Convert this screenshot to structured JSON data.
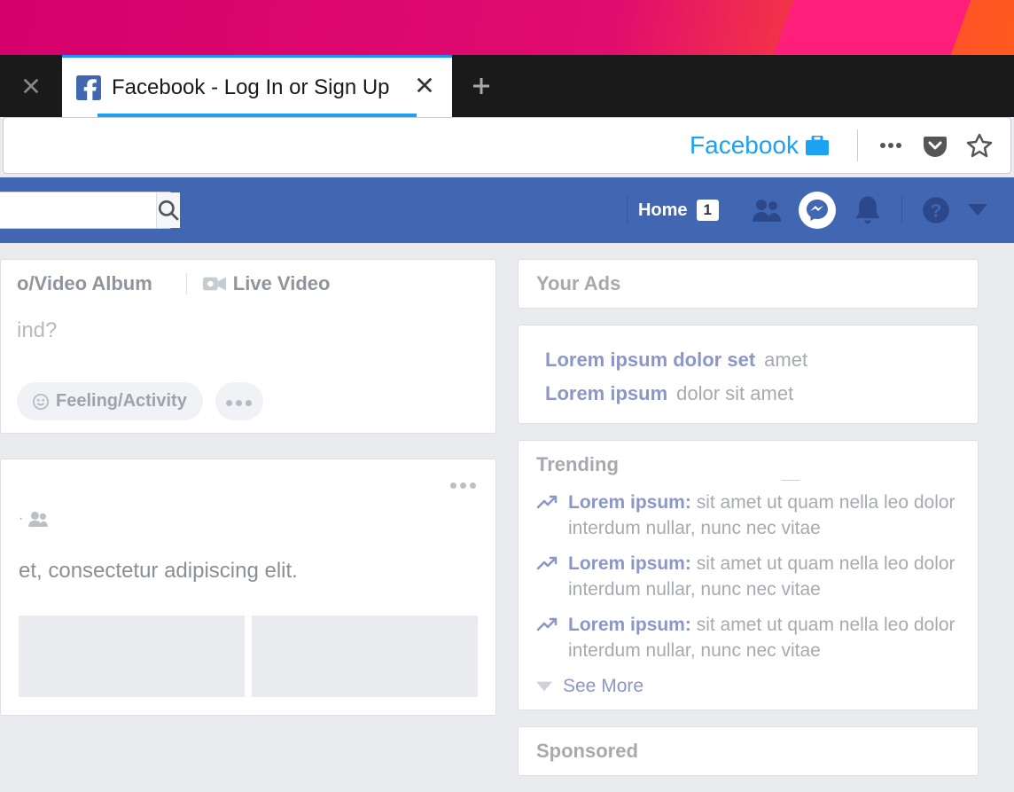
{
  "browser": {
    "active_tab_title": "Facebook - Log In or Sign Up",
    "address_site_label": "Facebook"
  },
  "fb": {
    "home_label": "Home",
    "home_badge": "1"
  },
  "composer": {
    "photo_album_label": "o/Video Album",
    "live_video_label": "Live Video",
    "prompt": "ind?",
    "feeling_label": "Feeling/Activity"
  },
  "post": {
    "body": "et, consectetur adipiscing elit."
  },
  "rightcol": {
    "your_ads_title": "Your Ads",
    "ads": [
      {
        "bold": "Lorem ipsum dolor set",
        "rest": "amet"
      },
      {
        "bold": "Lorem ipsum",
        "rest": "dolor sit amet"
      }
    ],
    "trending_title": "Trending",
    "trending": [
      {
        "bold": "Lorem ipsum:",
        "rest": "sit amet ut quam nella leo dolor interdum nullar, nunc nec vitae"
      },
      {
        "bold": "Lorem ipsum:",
        "rest": "sit amet ut quam nella leo dolor interdum nullar, nunc nec vitae"
      },
      {
        "bold": "Lorem ipsum:",
        "rest": "sit amet ut quam nella leo dolor interdum nullar, nunc nec vitae"
      }
    ],
    "see_more_label": "See More",
    "sponsored_title": "Sponsored"
  }
}
